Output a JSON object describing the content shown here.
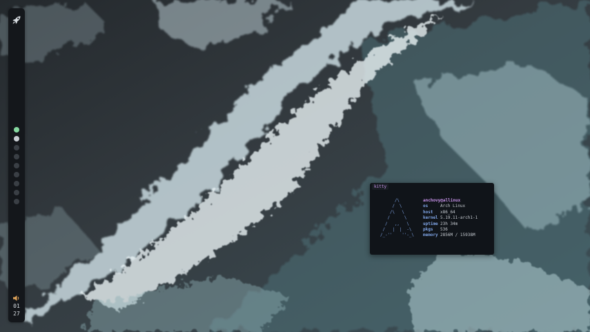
{
  "bar": {
    "launcher_icon": "rocket-icon",
    "workspaces": [
      {
        "state": "focused"
      },
      {
        "state": "occupied"
      },
      {
        "state": "empty"
      },
      {
        "state": "empty"
      },
      {
        "state": "empty"
      },
      {
        "state": "empty"
      },
      {
        "state": "empty"
      },
      {
        "state": "empty"
      },
      {
        "state": "empty"
      }
    ],
    "volume_icon": "speaker-icon",
    "clock": {
      "hour": "01",
      "minute": "27"
    },
    "colors": {
      "background": "#14171b",
      "focused": "#86d9a0",
      "occupied": "#c8cdd2",
      "empty": "#3a3f45",
      "volume": "#e0a45a"
    }
  },
  "terminal": {
    "title": "kitty",
    "ascii_logo": "      /\\\n     /  \\\n    /\\   \\\n   /      \\\n  /   ,,   \\\n /   |  |  -\\\n/_-''    ''-_\\",
    "user_host": "anchovy@allinux",
    "fields": [
      {
        "key": "os",
        "value": "Arch Linux"
      },
      {
        "key": "host",
        "value": "x86_64"
      },
      {
        "key": "kernel",
        "value": "5.19.11-arch1-1"
      },
      {
        "key": "uptime",
        "value": "23h 34m"
      },
      {
        "key": "pkgs",
        "value": "536"
      },
      {
        "key": "memory",
        "value": "2856M / 15938M"
      }
    ],
    "colors": {
      "background": "#101419",
      "accent": "#c792ea",
      "key": "#80a6e8",
      "text": "#c5cad0"
    }
  }
}
